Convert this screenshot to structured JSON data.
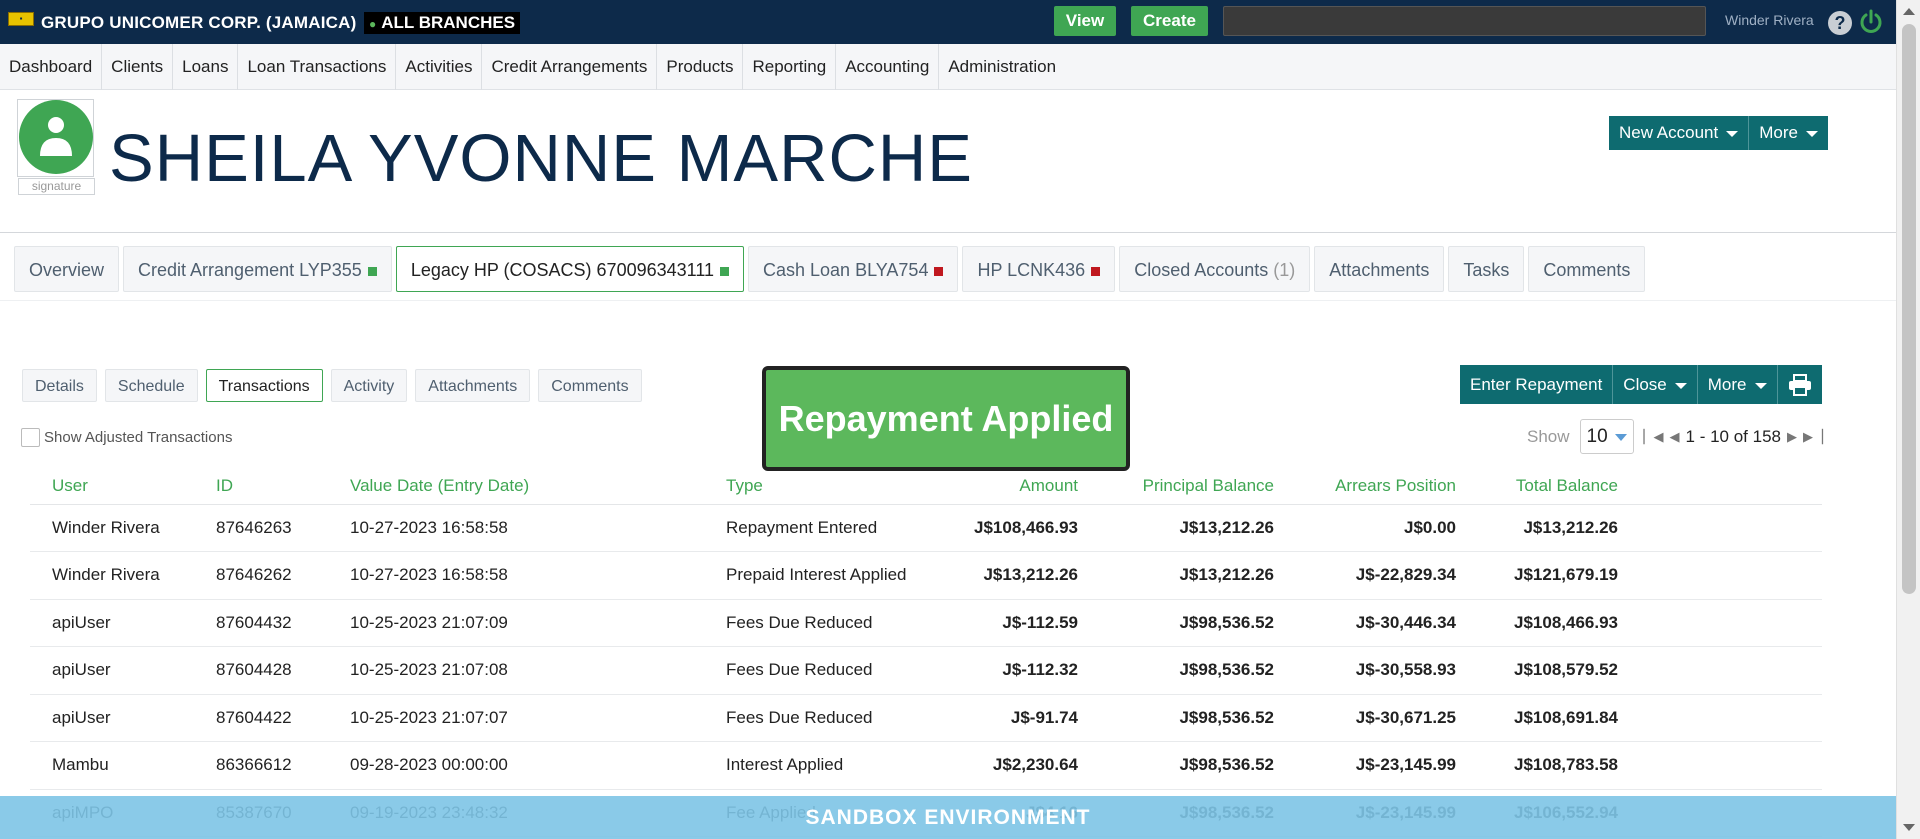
{
  "topbar": {
    "org_name": "GRUPO UNICOMER CORP. (JAMAICA)",
    "branch": "ALL BRANCHES",
    "view_label": "View",
    "create_label": "Create",
    "user": "Winder Rivera",
    "help_glyph": "?"
  },
  "menu": [
    {
      "label": "Dashboard"
    },
    {
      "label": "Clients"
    },
    {
      "label": "Loans"
    },
    {
      "label": "Loan Transactions"
    },
    {
      "label": "Activities"
    },
    {
      "label": "Credit Arrangements"
    },
    {
      "label": "Products"
    },
    {
      "label": "Reporting"
    },
    {
      "label": "Accounting"
    },
    {
      "label": "Administration"
    }
  ],
  "client": {
    "name": "SHEILA YVONNE MARCHE",
    "signature_label": "signature",
    "new_account_label": "New Account",
    "more_label": "More"
  },
  "account_tabs": [
    {
      "label": "Overview",
      "status": ""
    },
    {
      "label": "Credit Arrangement LYP355",
      "status": "green"
    },
    {
      "label": "Legacy HP (COSACS) 670096343111",
      "status": "green",
      "active": true
    },
    {
      "label": "Cash Loan BLYA754",
      "status": "red"
    },
    {
      "label": "HP LCNK436",
      "status": "red"
    },
    {
      "label": "Closed Accounts",
      "count": "(1)"
    },
    {
      "label": "Attachments"
    },
    {
      "label": "Tasks"
    },
    {
      "label": "Comments"
    }
  ],
  "sub_tabs": [
    {
      "label": "Details"
    },
    {
      "label": "Schedule"
    },
    {
      "label": "Transactions",
      "active": true
    },
    {
      "label": "Activity"
    },
    {
      "label": "Attachments"
    },
    {
      "label": "Comments"
    }
  ],
  "notice": "Repayment Applied",
  "actions": {
    "enter_repayment": "Enter Repayment",
    "close": "Close",
    "more": "More"
  },
  "show_adjusted_label": "Show Adjusted Transactions",
  "pager": {
    "show_label": "Show",
    "page_size": "10",
    "range": "1 - 10 of 158"
  },
  "table": {
    "headers": [
      "User",
      "ID",
      "Value Date (Entry Date)",
      "Type",
      "Amount",
      "Principal Balance",
      "Arrears Position",
      "Total Balance"
    ],
    "rows": [
      {
        "user": "Winder Rivera",
        "user_link": true,
        "id": "87646263",
        "date": "10-27-2023 16:58:58",
        "type": "Repayment Entered",
        "amount": "J$108,466.93",
        "amount_sign": "pos",
        "principal": "J$13,212.26",
        "arrears": "J$0.00",
        "arrears_sign": "pos",
        "total": "J$13,212.26"
      },
      {
        "user": "Winder Rivera",
        "user_link": true,
        "id": "87646262",
        "date": "10-27-2023 16:58:58",
        "type": "Prepaid Interest Applied",
        "amount": "J$13,212.26",
        "amount_sign": "pos",
        "principal": "J$13,212.26",
        "arrears": "J$-22,829.34",
        "arrears_sign": "neg",
        "total": "J$121,679.19"
      },
      {
        "user": "apiUser",
        "user_link": true,
        "id": "87604432",
        "date": "10-25-2023 21:07:09",
        "type": "Fees Due Reduced",
        "amount": "J$-112.59",
        "amount_sign": "neg",
        "principal": "J$98,536.52",
        "arrears": "J$-30,446.34",
        "arrears_sign": "neg",
        "total": "J$108,466.93"
      },
      {
        "user": "apiUser",
        "user_link": true,
        "id": "87604428",
        "date": "10-25-2023 21:07:08",
        "type": "Fees Due Reduced",
        "amount": "J$-112.32",
        "amount_sign": "neg",
        "principal": "J$98,536.52",
        "arrears": "J$-30,558.93",
        "arrears_sign": "neg",
        "total": "J$108,579.52"
      },
      {
        "user": "apiUser",
        "user_link": true,
        "id": "87604422",
        "date": "10-25-2023 21:07:07",
        "type": "Fees Due Reduced",
        "amount": "J$-91.74",
        "amount_sign": "neg",
        "principal": "J$98,536.52",
        "arrears": "J$-30,671.25",
        "arrears_sign": "neg",
        "total": "J$108,691.84"
      },
      {
        "user": "Mambu",
        "user_link": false,
        "id": "86366612",
        "date": "09-28-2023 00:00:00",
        "type": "Interest Applied",
        "amount": "J$2,230.64",
        "amount_sign": "pos",
        "principal": "J$98,536.52",
        "arrears": "J$-23,145.99",
        "arrears_sign": "neg",
        "total": "J$108,783.58"
      },
      {
        "user": "apiMPO",
        "user_link": true,
        "id": "85387670",
        "date": "09-19-2023 23:48:32",
        "type": "Fee Applied",
        "amount": "J$4.16",
        "amount_sign": "pos",
        "principal": "J$98,536.52",
        "arrears": "J$-23,145.99",
        "arrears_sign": "neg",
        "total": "J$106,552.94"
      }
    ]
  },
  "sandbox_banner": "SANDBOX ENVIRONMENT",
  "colors": {
    "brand_navy": "#0d2a4a",
    "accent_green": "#3fa653",
    "teal": "#0e6b70",
    "positive": "#1e7b1e",
    "negative": "#a01515"
  }
}
